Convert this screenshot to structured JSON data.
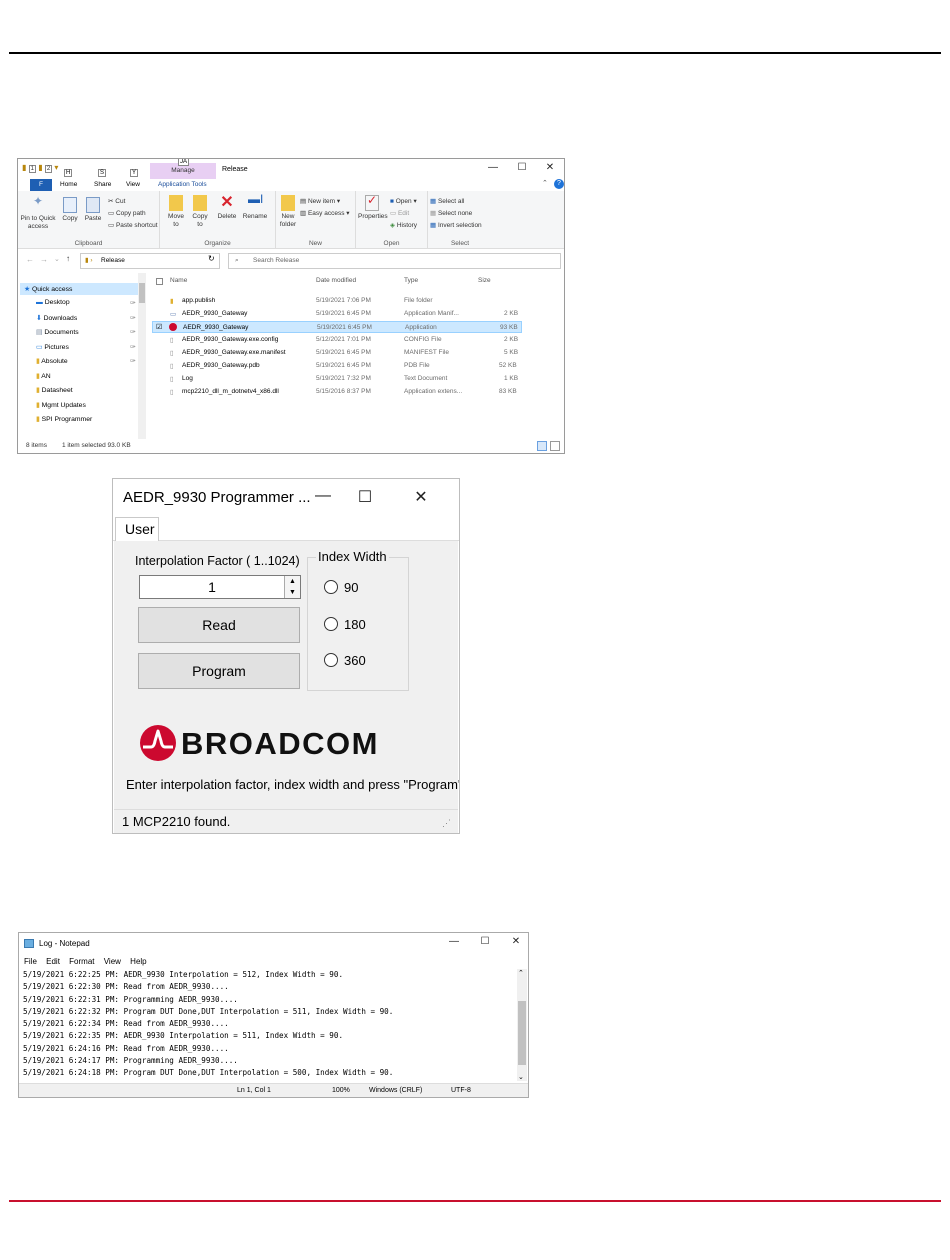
{
  "explorer": {
    "title": "Release",
    "manage_tab": "Manage",
    "tabs": {
      "file": "F",
      "home": "Home",
      "share": "Share",
      "view": "View",
      "app_tools": "Application Tools"
    },
    "keytips": {
      "qat1": "1",
      "qat2": "2",
      "home": "H",
      "share": "S",
      "view": "Y",
      "manage": "JA"
    },
    "ribbon": {
      "pin": "Pin to Quick access",
      "copy": "Copy",
      "paste": "Paste",
      "cut": "Cut",
      "copy_path": "Copy path",
      "paste_shortcut": "Paste shortcut",
      "clipboard": "Clipboard",
      "move_to": "Move to",
      "copy_to": "Copy to",
      "delete": "Delete",
      "rename": "Rename",
      "organize": "Organize",
      "new_folder": "New folder",
      "new_item": "New item",
      "easy_access": "Easy access",
      "new": "New",
      "properties": "Properties",
      "open": "Open",
      "edit": "Edit",
      "history": "History",
      "open_group": "Open",
      "select_all": "Select all",
      "select_none": "Select none",
      "invert_selection": "Invert selection",
      "select": "Select"
    },
    "address": "Release",
    "search_placeholder": "Search Release",
    "nav": [
      "Quick access",
      "Desktop",
      "Downloads",
      "Documents",
      "Pictures",
      "Absolute",
      "AN",
      "Datasheet",
      "Mgmt Updates",
      "SPI Programmer"
    ],
    "columns": {
      "name": "Name",
      "date": "Date modified",
      "type": "Type",
      "size": "Size"
    },
    "files": [
      {
        "name": "app.publish",
        "date": "5/19/2021 7:06 PM",
        "type": "File folder",
        "size": ""
      },
      {
        "name": "AEDR_9930_Gateway",
        "date": "5/19/2021 6:45 PM",
        "type": "Application Manif...",
        "size": "2 KB"
      },
      {
        "name": "AEDR_9930_Gateway",
        "date": "5/19/2021 6:45 PM",
        "type": "Application",
        "size": "93 KB"
      },
      {
        "name": "AEDR_9930_Gateway.exe.config",
        "date": "5/12/2021 7:01 PM",
        "type": "CONFIG File",
        "size": "2 KB"
      },
      {
        "name": "AEDR_9930_Gateway.exe.manifest",
        "date": "5/19/2021 6:45 PM",
        "type": "MANIFEST File",
        "size": "5 KB"
      },
      {
        "name": "AEDR_9930_Gateway.pdb",
        "date": "5/19/2021 6:45 PM",
        "type": "PDB File",
        "size": "52 KB"
      },
      {
        "name": "Log",
        "date": "5/19/2021 7:32 PM",
        "type": "Text Document",
        "size": "1 KB"
      },
      {
        "name": "mcp2210_dll_m_dotnetv4_x86.dll",
        "date": "5/15/2016 8:37 PM",
        "type": "Application extens...",
        "size": "83 KB"
      }
    ],
    "status": {
      "count": "8 items",
      "selected": "1 item selected  93.0 KB"
    }
  },
  "programmer": {
    "title": "AEDR_9930 Programmer ...",
    "tab": "User",
    "interp_label": "Interpolation Factor ( 1..1024)",
    "interp_value": "1",
    "read": "Read",
    "program": "Program",
    "index_width_legend": "Index Width",
    "radios": [
      "90",
      "180",
      "360"
    ],
    "logo_text": "BROADCOM",
    "hint": "Enter interpolation factor, index width and press \"Program\"",
    "status": "1 MCP2210 found."
  },
  "notepad": {
    "title": "Log - Notepad",
    "menu": [
      "File",
      "Edit",
      "Format",
      "View",
      "Help"
    ],
    "lines": [
      "5/19/2021 6:22:25 PM: AEDR_9930 Interpolation = 512, Index Width = 90.",
      "5/19/2021 6:22:30 PM: Read from AEDR_9930....",
      "5/19/2021 6:22:31 PM: Programming AEDR_9930....",
      "5/19/2021 6:22:32 PM: Program DUT Done,DUT Interpolation = 511, Index Width = 90.",
      "5/19/2021 6:22:34 PM: Read from AEDR_9930....",
      "5/19/2021 6:22:35 PM: AEDR_9930 Interpolation = 511, Index Width = 90.",
      "5/19/2021 6:24:16 PM: Read from AEDR_9930....",
      "5/19/2021 6:24:17 PM: Programming AEDR_9930....",
      "5/19/2021 6:24:18 PM: Program DUT Done,DUT Interpolation = 500, Index Width = 90."
    ],
    "status": {
      "position": "Ln 1, Col 1",
      "zoom": "100%",
      "eol": "Windows (CRLF)",
      "encoding": "UTF-8"
    }
  },
  "colors": {
    "accent_red": "#c8102e",
    "logo_red": "#cc092f",
    "file_tab": "#1e5fb3",
    "manage_tab": "#e8cff3"
  }
}
